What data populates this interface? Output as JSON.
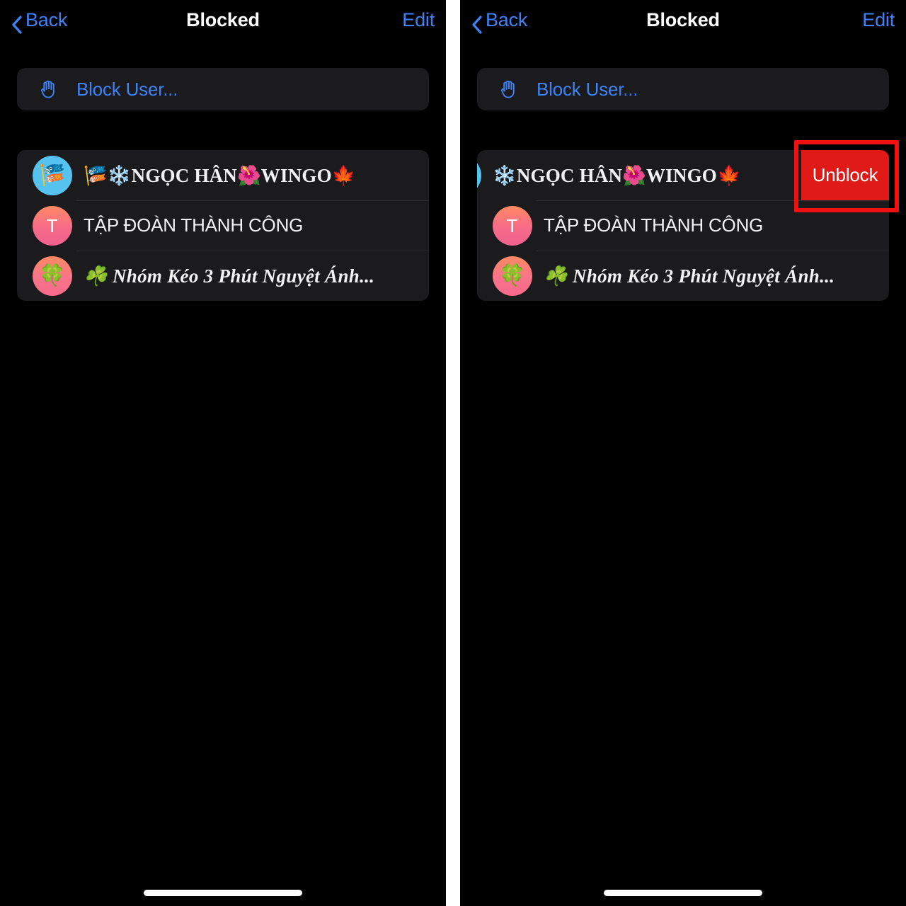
{
  "nav": {
    "back_label": "Back",
    "title": "Blocked",
    "edit_label": "Edit",
    "back_icon": "chevron-left-icon"
  },
  "block_user": {
    "icon": "raised-hand-icon",
    "label": "Block User..."
  },
  "contacts": [
    {
      "avatar_type": "image",
      "avatar_emoji": "🎏",
      "avatar_color": "#55C2F0",
      "name": "🎏❄️NGỌC HÂN🌺WINGO🍁",
      "name_style": "serif"
    },
    {
      "avatar_type": "initial",
      "avatar_letter": "T",
      "avatar_color": "#F76B8A",
      "name": "TẬP ĐOÀN THÀNH CÔNG",
      "name_style": "sans"
    },
    {
      "avatar_type": "image",
      "avatar_emoji": "🍀",
      "avatar_color": "#F56A8A",
      "name": "☘️ Nhóm Kéo 3 Phút Nguyệt Ánh...",
      "name_style": "script"
    }
  ],
  "swipe_action": {
    "label": "Unblock",
    "color": "#E01B17",
    "swiped_row_name": "❄️NGỌC HÂN🌺WINGO🍁"
  },
  "annotation": {
    "shape": "rectangle",
    "color": "#F01010",
    "target": "unblock-button"
  },
  "colors": {
    "background": "#000000",
    "card": "#1B1B1D",
    "accent_blue": "#3E82F7",
    "destructive_red": "#E01B17",
    "separator": "#2D2D2F",
    "text_primary": "#F2F2F2"
  }
}
